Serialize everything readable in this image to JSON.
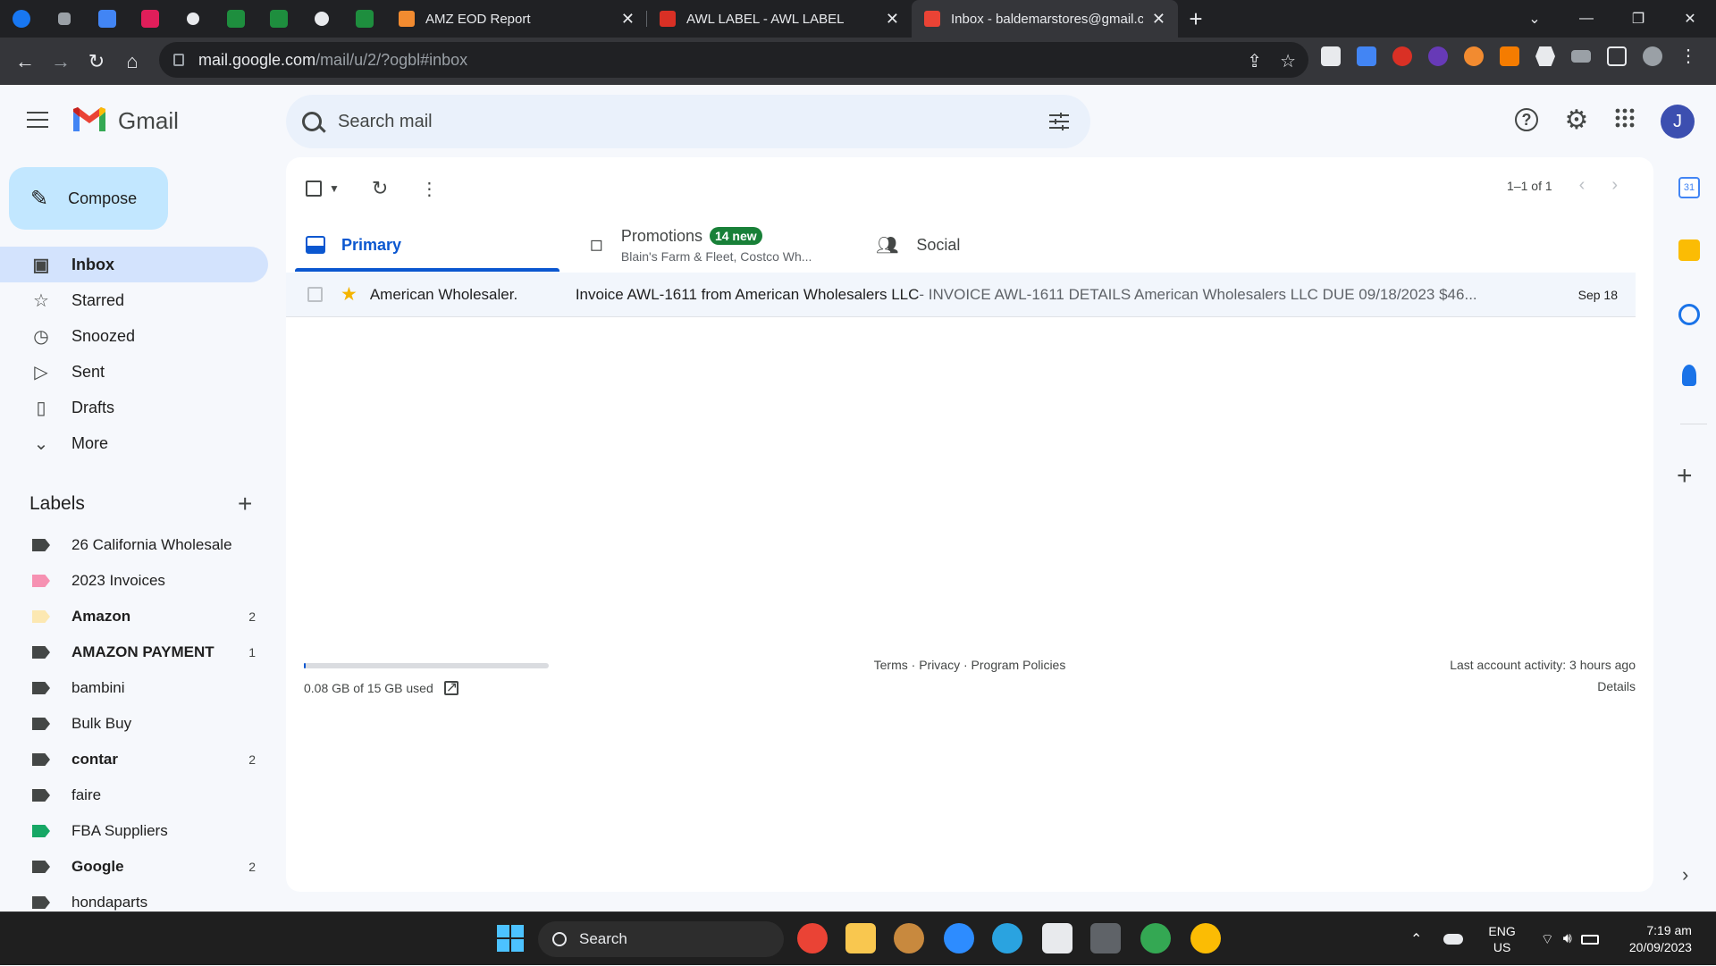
{
  "browser": {
    "tabs": [
      {
        "title": "AMZ EOD Report",
        "favicon_color": "#f28b30"
      },
      {
        "title": "AWL LABEL - AWL LABEL",
        "favicon_color": "#d93025"
      },
      {
        "title": "Inbox - baldemarstores@gmail.co",
        "favicon_color": "#ea4335",
        "active": true
      }
    ],
    "new_tab": "+",
    "url_host": "mail.google.com",
    "url_path": "/mail/u/2/?ogbl#inbox"
  },
  "gmail": {
    "brand": "Gmail",
    "search_placeholder": "Search mail",
    "avatar_letter": "J",
    "compose": "Compose",
    "nav": [
      {
        "label": "Inbox",
        "icon": "inbox-icon",
        "glyph": "▣",
        "active": true
      },
      {
        "label": "Starred",
        "icon": "star-icon",
        "glyph": "☆"
      },
      {
        "label": "Snoozed",
        "icon": "clock-icon",
        "glyph": "◷"
      },
      {
        "label": "Sent",
        "icon": "send-icon",
        "glyph": "▷"
      },
      {
        "label": "Drafts",
        "icon": "draft-icon",
        "glyph": "▯"
      },
      {
        "label": "More",
        "icon": "chevron-down-icon",
        "glyph": "⌄"
      }
    ],
    "labels_heading": "Labels",
    "labels": [
      {
        "name": "26 California Wholesale",
        "color": "#444746",
        "count": "",
        "bold": false
      },
      {
        "name": "2023 Invoices",
        "color": "#f691b2",
        "count": "",
        "bold": false
      },
      {
        "name": "Amazon",
        "color": "#fce8b2",
        "count": "2",
        "bold": true
      },
      {
        "name": "AMAZON PAYMENT",
        "color": "#444746",
        "count": "1",
        "bold": true
      },
      {
        "name": "bambini",
        "color": "#444746",
        "count": "",
        "bold": false
      },
      {
        "name": "Bulk Buy",
        "color": "#444746",
        "count": "",
        "bold": false
      },
      {
        "name": "contar",
        "color": "#444746",
        "count": "2",
        "bold": true
      },
      {
        "name": "faire",
        "color": "#444746",
        "count": "",
        "bold": false
      },
      {
        "name": "FBA Suppliers",
        "color": "#16a765",
        "count": "",
        "bold": false
      },
      {
        "name": "Google",
        "color": "#444746",
        "count": "2",
        "bold": true
      },
      {
        "name": "hondaparts",
        "color": "#444746",
        "count": "",
        "bold": false
      }
    ],
    "pager": "1–1 of 1",
    "tabs": {
      "primary": "Primary",
      "promotions": "Promotions",
      "promotions_badge": "14 new",
      "promotions_sub": "Blain's Farm & Fleet, Costco Wh...",
      "social": "Social"
    },
    "emails": [
      {
        "sender": "American Wholesaler.",
        "subject": "Invoice AWL-1611 from American Wholesalers LLC",
        "snippet": " - INVOICE AWL-1611 DETAILS American Wholesalers LLC DUE 09/18/2023 $46...",
        "date": "Sep 18",
        "starred": true
      }
    ],
    "footer": {
      "storage": "0.08 GB of 15 GB used",
      "storage_fraction": 0.0053,
      "links": "Terms · Privacy · Program Policies",
      "activity": "Last account activity: 3 hours ago",
      "details": "Details"
    }
  },
  "taskbar": {
    "search": "Search",
    "lang": "ENG",
    "region": "US",
    "time": "7:19 am",
    "date": "20/09/2023"
  }
}
